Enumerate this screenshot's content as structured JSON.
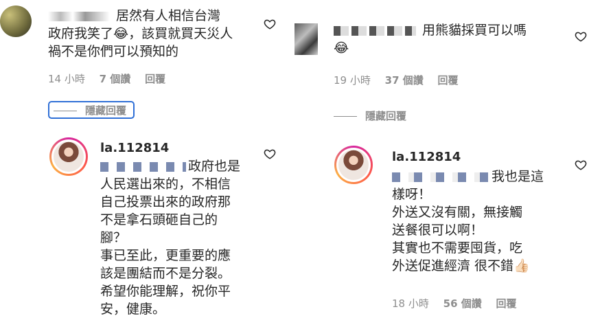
{
  "left": {
    "comment1": {
      "text_line1": "居然有人相信台灣",
      "text_line2": "政府我笑了😂，該買就買天災人",
      "text_line3": "禍不是你們可以預知的",
      "meta": {
        "time": "14 小時",
        "likes": "7 個讚",
        "reply": "回覆"
      }
    },
    "hide_replies": "隱藏回覆",
    "reply1": {
      "username": "la.112814",
      "line1": "政府也是",
      "line2": "人民選出來的，不相信",
      "line3": "自己投票出來的政府那",
      "line4": "不是拿石頭砸自己的",
      "line5": "腳？",
      "line6": "事已至此，更重要的應",
      "line7": "該是團結而不是分裂。",
      "line8": "希望你能理解，祝你平",
      "line9": "安，健康。"
    }
  },
  "right": {
    "comment2": {
      "text_line1": "用熊貓採買可以嗎",
      "text_line2": "😂",
      "meta": {
        "time": "19 小時",
        "likes": "37 個讚",
        "reply": "回覆"
      }
    },
    "hide_replies": "隱藏回覆",
    "reply2": {
      "username": "la.112814",
      "line1": "我也是這",
      "line2": "樣呀！",
      "line3": "外送又沒有關，無接觸",
      "line4": "送餐很可以啊！",
      "line5": "其實也不需要囤貨，吃",
      "line6": "外送促進經濟 很不錯👍🏻",
      "meta": {
        "time": "18 小時",
        "likes": "56 個讚",
        "reply": "回覆"
      }
    }
  },
  "icons": {
    "heart": "heart-outline-icon"
  },
  "colors": {
    "meta": "#8e8e8e",
    "text": "#262626",
    "focus": "#2f6fd6"
  }
}
